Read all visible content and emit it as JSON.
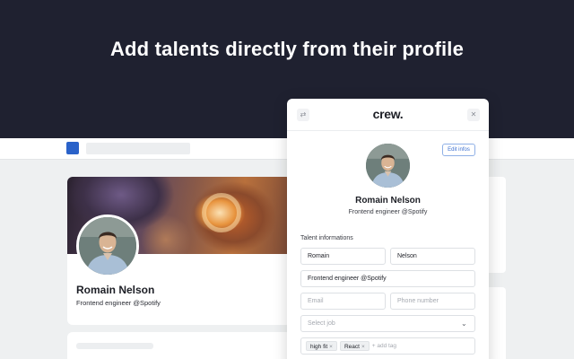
{
  "hero": {
    "title": "Add talents directly from their profile"
  },
  "profile": {
    "name": "Romain Nelson",
    "role": "Frontend engineer @Spotify"
  },
  "panel": {
    "logo": "crew.",
    "edit_label": "Edit infos",
    "name": "Romain Nelson",
    "role": "Frontend engineer @Spotify",
    "section_label": "Talent informations",
    "fields": {
      "first_name": "Romain",
      "last_name": "Nelson",
      "headline": "Frontend engineer @Spotify",
      "email_placeholder": "Email",
      "phone_placeholder": "Phone number",
      "job_placeholder": "Select job"
    },
    "tags": [
      {
        "label": "high fit"
      },
      {
        "label": "React"
      }
    ],
    "add_tag_placeholder": "+ add tag"
  },
  "icons": {
    "switch": "switch-icon",
    "close": "close-icon",
    "chevron": "chevron-down-icon",
    "tag_remove": "×"
  },
  "colors": {
    "hero_bg": "#1f2130",
    "accent": "#3a6fd0",
    "linkedin_blue": "#2a62c9"
  }
}
